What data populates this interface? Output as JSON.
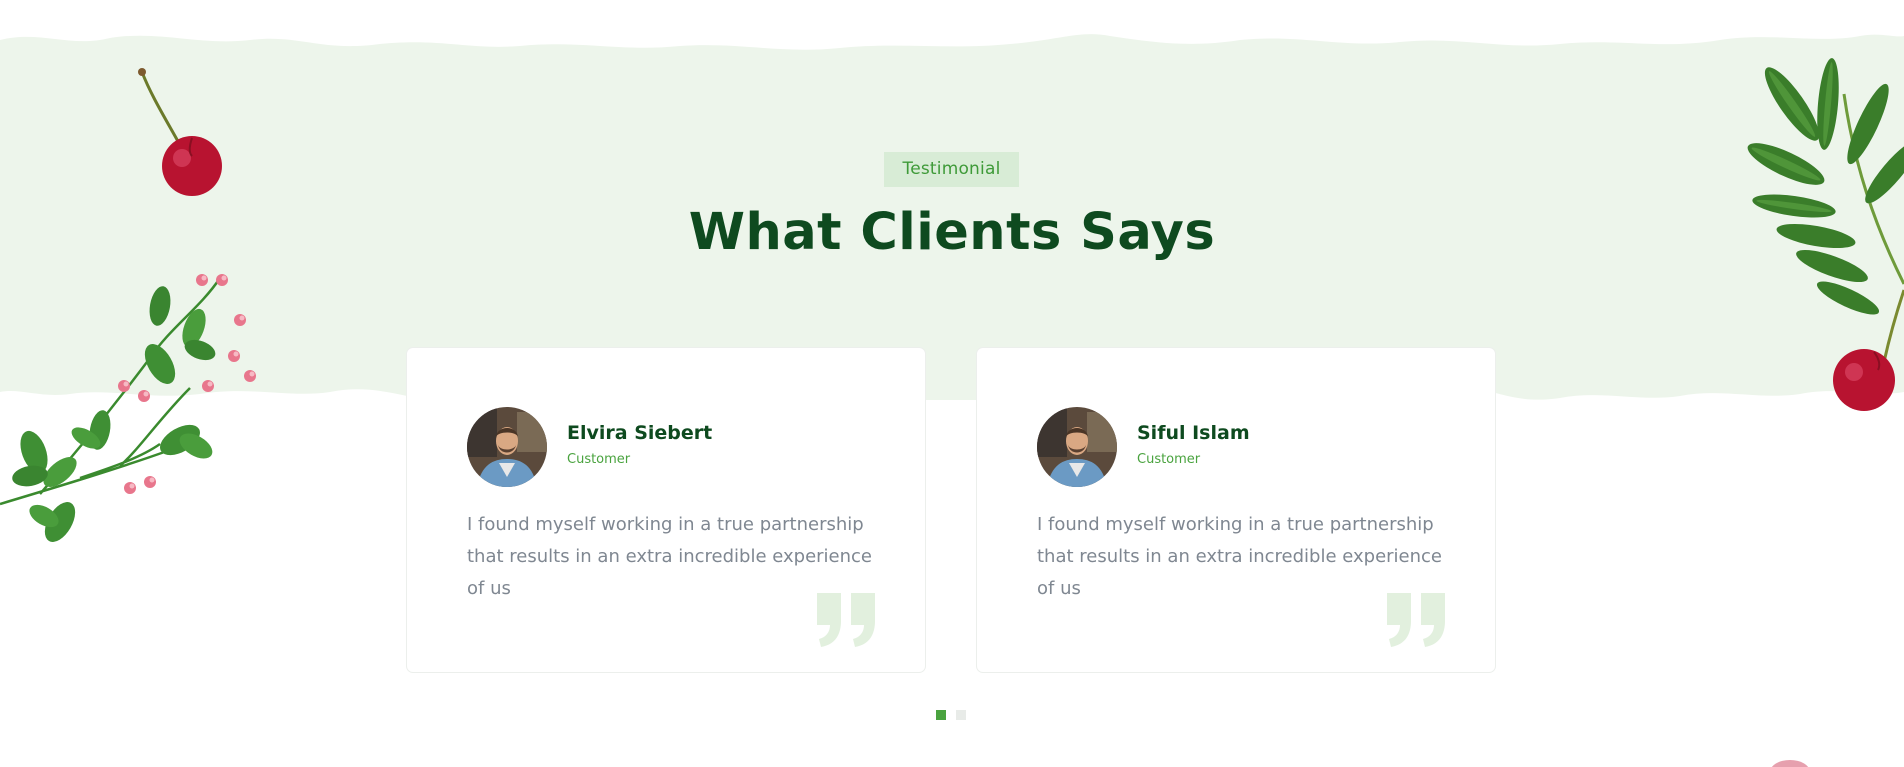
{
  "section": {
    "badge": "Testimonial",
    "title": "What Clients Says"
  },
  "colors": {
    "band": "#edf5eb",
    "accent": "#4aa33f",
    "heading": "#0e4a1f",
    "body_text": "#7f8791"
  },
  "testimonials": [
    {
      "name": "Elvira Siebert",
      "role": "Customer",
      "quote": "I found myself working in a true partnership that results in an extra incredible experience of us",
      "avatar_icon": "avatar"
    },
    {
      "name": "Siful Islam",
      "role": "Customer",
      "quote": "I found myself working in a true partnership that results in an extra incredible experience of us",
      "avatar_icon": "avatar"
    }
  ],
  "pagination": {
    "pages": 2,
    "active": 1
  },
  "decorations": [
    "cherry-icon",
    "flower-branch-icon",
    "leaf-branch-icon",
    "cherry-icon"
  ]
}
